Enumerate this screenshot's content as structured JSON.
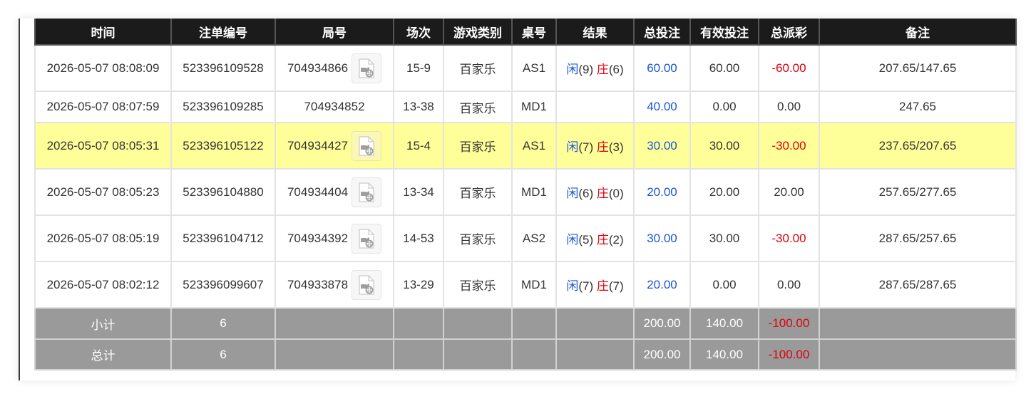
{
  "columns": [
    "时间",
    "注单编号",
    "局号",
    "场次",
    "游戏类别",
    "桌号",
    "结果",
    "总投注",
    "有效投注",
    "总派彩",
    "备注"
  ],
  "result_labels": {
    "player": "闲",
    "banker": "庄"
  },
  "rows": [
    {
      "time": "2026-05-07 08:08:09",
      "bet_no": "523396109528",
      "round": "704934866",
      "has_video": true,
      "shoe": "15-9",
      "game": "百家乐",
      "table": "AS1",
      "player": "(9)",
      "banker": "(6)",
      "total_bet": "60.00",
      "valid_bet": "60.00",
      "payout": "-60.00",
      "note": "207.65/147.65",
      "highlight": false
    },
    {
      "time": "2026-05-07 08:07:59",
      "bet_no": "523396109285",
      "round": "704934852",
      "has_video": false,
      "shoe": "13-38",
      "game": "百家乐",
      "table": "MD1",
      "player": "",
      "banker": "",
      "total_bet": "40.00",
      "valid_bet": "0.00",
      "payout": "0.00",
      "note": "247.65",
      "highlight": false
    },
    {
      "time": "2026-05-07 08:05:31",
      "bet_no": "523396105122",
      "round": "704934427",
      "has_video": true,
      "shoe": "15-4",
      "game": "百家乐",
      "table": "AS1",
      "player": "(7)",
      "banker": "(3)",
      "total_bet": "30.00",
      "valid_bet": "30.00",
      "payout": "-30.00",
      "note": "237.65/207.65",
      "highlight": true
    },
    {
      "time": "2026-05-07 08:05:23",
      "bet_no": "523396104880",
      "round": "704934404",
      "has_video": true,
      "shoe": "13-34",
      "game": "百家乐",
      "table": "MD1",
      "player": "(6)",
      "banker": "(0)",
      "total_bet": "20.00",
      "valid_bet": "20.00",
      "payout": "20.00",
      "note": "257.65/277.65",
      "highlight": false
    },
    {
      "time": "2026-05-07 08:05:19",
      "bet_no": "523396104712",
      "round": "704934392",
      "has_video": true,
      "shoe": "14-53",
      "game": "百家乐",
      "table": "AS2",
      "player": "(5)",
      "banker": "(2)",
      "total_bet": "30.00",
      "valid_bet": "30.00",
      "payout": "-30.00",
      "note": "287.65/257.65",
      "highlight": false
    },
    {
      "time": "2026-05-07 08:02:12",
      "bet_no": "523396099607",
      "round": "704933878",
      "has_video": true,
      "shoe": "13-29",
      "game": "百家乐",
      "table": "MD1",
      "player": "(7)",
      "banker": "(7)",
      "total_bet": "20.00",
      "valid_bet": "0.00",
      "payout": "0.00",
      "note": "287.65/287.65",
      "highlight": false
    }
  ],
  "subtotal": {
    "label": "小计",
    "count": "6",
    "total_bet": "200.00",
    "valid_bet": "140.00",
    "payout": "-100.00"
  },
  "total": {
    "label": "总计",
    "count": "6",
    "total_bet": "200.00",
    "valid_bet": "140.00",
    "payout": "-100.00"
  },
  "colors": {
    "header_bg": "#1b1b1b",
    "highlight_row": "#ffff9a",
    "footer_bg": "#9a9a9a",
    "blue": "#1a56d6",
    "red": "#e0000b"
  }
}
